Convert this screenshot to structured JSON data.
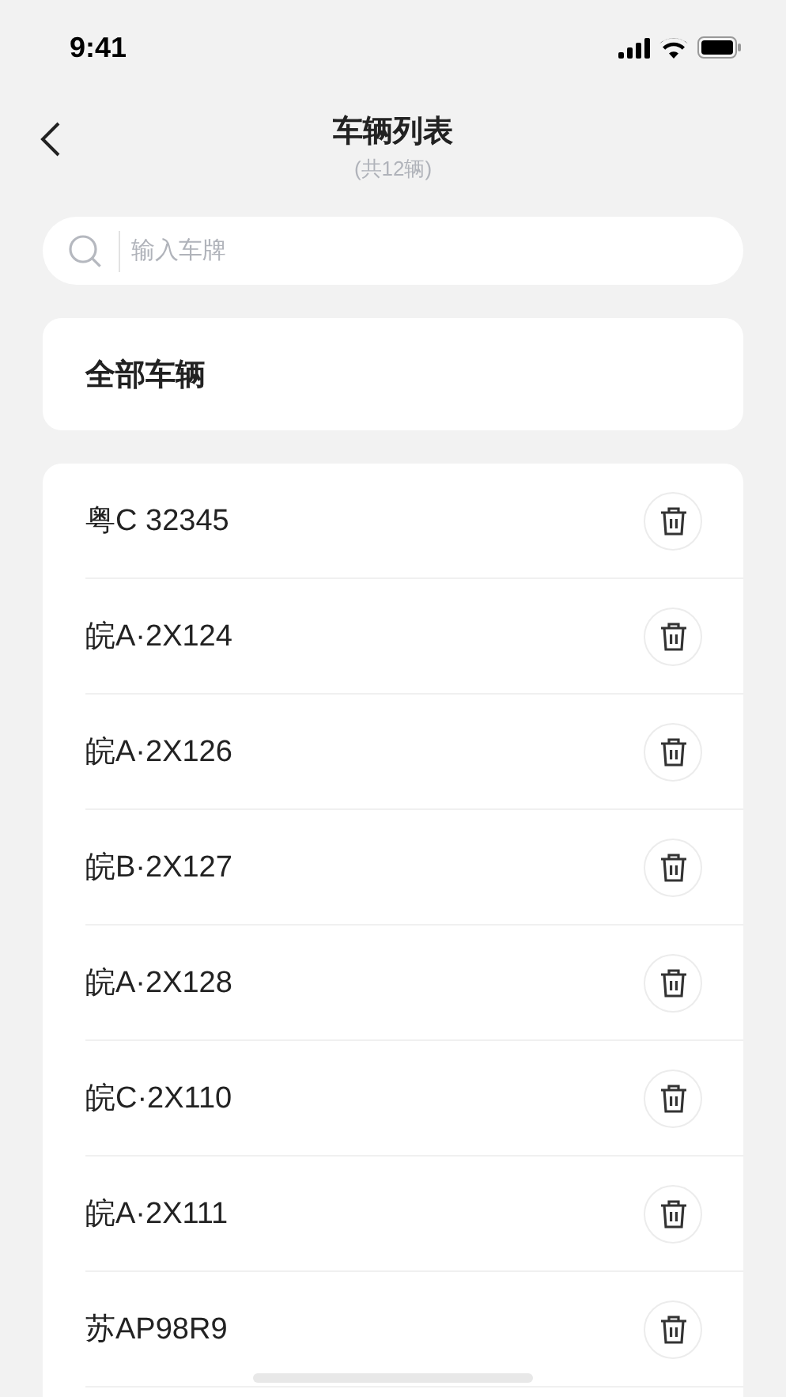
{
  "status_bar": {
    "time": "9:41"
  },
  "header": {
    "title": "车辆列表",
    "subtitle": "(共12辆)"
  },
  "search": {
    "placeholder": "输入车牌"
  },
  "all_vehicles": {
    "label": "全部车辆"
  },
  "vehicles": [
    {
      "plate": "粤C 32345"
    },
    {
      "plate": "皖A·2X124"
    },
    {
      "plate": "皖A·2X126"
    },
    {
      "plate": "皖B·2X127"
    },
    {
      "plate": "皖A·2X128"
    },
    {
      "plate": "皖C·2X110"
    },
    {
      "plate": "皖A·2X111"
    },
    {
      "plate": "苏AP98R9"
    }
  ]
}
